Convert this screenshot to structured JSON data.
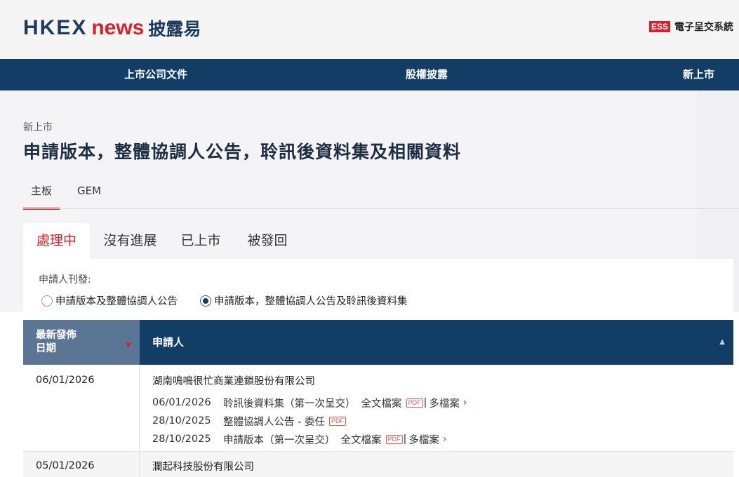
{
  "header": {
    "logo_hkex": "HKEX",
    "logo_news": "news",
    "logo_zh": "披露易",
    "ess_badge": "ESS",
    "ess_label": "電子呈交系統"
  },
  "nav": {
    "items": [
      "上市公司文件",
      "股權披露",
      "新上市"
    ]
  },
  "breadcrumb": "新上市",
  "page_title": "申請版本，整體協調人公告，聆訊後資料集及相關資料",
  "board_tabs": [
    "主板",
    "GEM"
  ],
  "status_tabs": [
    "處理中",
    "沒有進展",
    "已上市",
    "被發回"
  ],
  "filter": {
    "label": "申請人刊發:",
    "options": [
      "申請版本及整體協調人公告",
      "申請版本，整體協調人公告及聆訊後資料集"
    ],
    "selected_index": 1
  },
  "table": {
    "headers": {
      "date": "最新發佈日期",
      "date_line1": "最新發佈",
      "date_line2": "日期",
      "applicant": "申請人"
    },
    "rows": [
      {
        "date": "06/01/2026",
        "company": "湖南鳴鳴很忙商業連鎖股份有限公司",
        "docs": [
          {
            "date": "06/01/2026",
            "name": "聆訊後資料集（第一次呈交）",
            "link": "全文檔案",
            "pdf": "PDF",
            "more": "多檔案"
          },
          {
            "date": "28/10/2025",
            "name": "整體協調人公告 - 委任",
            "pdf": "PDF"
          },
          {
            "date": "28/10/2025",
            "name": "申請版本（第一次呈交）",
            "link": "全文檔案",
            "pdf": "PDF",
            "more": "多檔案"
          }
        ]
      },
      {
        "date": "05/01/2026",
        "company": "瀾起科技股份有限公司",
        "docs": []
      }
    ]
  }
}
